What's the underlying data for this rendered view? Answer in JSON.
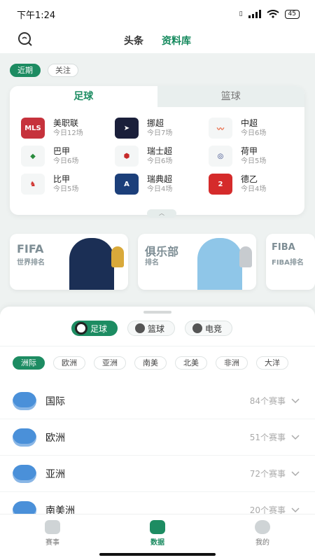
{
  "status_bar": {
    "time": "下午1:24",
    "battery": "45"
  },
  "header": {
    "tabs": [
      {
        "label": "头条",
        "active": false
      },
      {
        "label": "资料库",
        "active": true
      }
    ]
  },
  "filters": [
    {
      "label": "近期",
      "active": true
    },
    {
      "label": "关注",
      "active": false
    }
  ],
  "league_card": {
    "tabs": [
      {
        "label": "足球",
        "active": true
      },
      {
        "label": "篮球",
        "active": false
      }
    ],
    "leagues": [
      {
        "name": "美职联",
        "count": "今日12场",
        "logo": "mls-logo",
        "color": "#c6323c"
      },
      {
        "name": "挪超",
        "count": "今日7场",
        "logo": "eliteserien-logo",
        "color": "#1a1f3a"
      },
      {
        "name": "中超",
        "count": "今日6场",
        "logo": "csl-logo",
        "color": "#e8542a"
      },
      {
        "name": "巴甲",
        "count": "今日6场",
        "logo": "brasileirao-logo",
        "color": "#2a8b3d"
      },
      {
        "name": "瑞士超",
        "count": "今日6场",
        "logo": "swiss-super-league-logo",
        "color": "#c62a2a"
      },
      {
        "name": "荷甲",
        "count": "今日5场",
        "logo": "eredivisie-logo",
        "color": "#2c3e80"
      },
      {
        "name": "比甲",
        "count": "今日5场",
        "logo": "jupiler-pro-league-logo",
        "color": "#d0322e"
      },
      {
        "name": "瑞典超",
        "count": "今日4场",
        "logo": "allsvenskan-logo",
        "color": "#1c3f7a"
      },
      {
        "name": "德乙",
        "count": "今日4场",
        "logo": "2-bundesliga-logo",
        "color": "#d52b2b"
      }
    ]
  },
  "rankings": [
    {
      "title": "FIFA",
      "sub": "世界排名"
    },
    {
      "title": "俱乐部",
      "sub": "排名"
    },
    {
      "title": "FIBA",
      "sub": "FIBA排名"
    }
  ],
  "sheet": {
    "sport_tabs": [
      {
        "label": "足球",
        "icon": "soccer-ball-icon",
        "active": true
      },
      {
        "label": "篮球",
        "icon": "basketball-icon",
        "active": false
      },
      {
        "label": "电竞",
        "icon": "esports-icon",
        "active": false
      }
    ],
    "regions": [
      {
        "label": "洲际",
        "active": true
      },
      {
        "label": "欧洲",
        "active": false
      },
      {
        "label": "亚洲",
        "active": false
      },
      {
        "label": "南美",
        "active": false
      },
      {
        "label": "北美",
        "active": false
      },
      {
        "label": "非洲",
        "active": false
      },
      {
        "label": "大洋",
        "active": false
      }
    ],
    "continents": [
      {
        "name": "国际",
        "count": "84个赛事"
      },
      {
        "name": "欧洲",
        "count": "51个赛事"
      },
      {
        "name": "亚洲",
        "count": "72个赛事"
      },
      {
        "name": "南美洲",
        "count": "20个赛事"
      }
    ]
  },
  "bottom_nav": [
    {
      "label": "赛事",
      "icon": "trophy-icon",
      "active": false
    },
    {
      "label": "数据",
      "icon": "data-book-icon",
      "active": true
    },
    {
      "label": "我的",
      "icon": "profile-icon",
      "active": false
    }
  ],
  "colors": {
    "accent": "#1d8c62",
    "background": "#eef2f1"
  }
}
